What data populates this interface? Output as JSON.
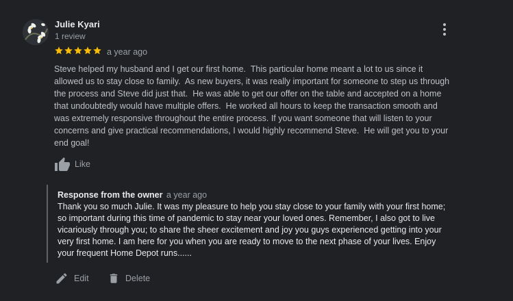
{
  "reviewer": {
    "name": "Julie Kyari",
    "review_count": "1 review"
  },
  "review": {
    "rating": 5,
    "date": "a year ago",
    "text": "Steve helped my husband and I get our first home.  This particular home meant a lot to us since it\nallowed us to stay close to family.  As new buyers, it was really important for someone to step us through\nthe process and Steve did just that.  He was able to get our offer on the table and accepted on a home\nthat undoubtedly would have multiple offers.  He worked all hours to keep the transaction smooth and\nwas extremely responsive throughout the entire process. If you want someone that will listen to your\nconcerns and give practical recommendations, I would highly recommend Steve.  He will get you to your\nend goal!",
    "like_label": "Like"
  },
  "owner_response": {
    "heading": "Response from the owner",
    "date": "a year ago",
    "text": "Thank you so much Julie. It was my pleasure to help you stay close to your family with your first home;\nso important during this time of pandemic to stay near your loved ones. Remember, I also got to live\nvicariously through you; to share the sheer excitement and joy you guys experienced getting into your\nvery first home. I am here for you when you are ready to move to the next phase of your lives. Enjoy\nyour frequent Home Depot runs......"
  },
  "actions": {
    "edit_label": "Edit",
    "delete_label": "Delete"
  },
  "icons": {
    "star": "star-icon",
    "like": "thumb-up-icon",
    "more": "more-vert-icon",
    "edit": "pencil-icon",
    "delete": "trash-icon"
  },
  "colors": {
    "star": "#fbbc04",
    "background": "#202124",
    "muted": "#9aa0a6"
  }
}
